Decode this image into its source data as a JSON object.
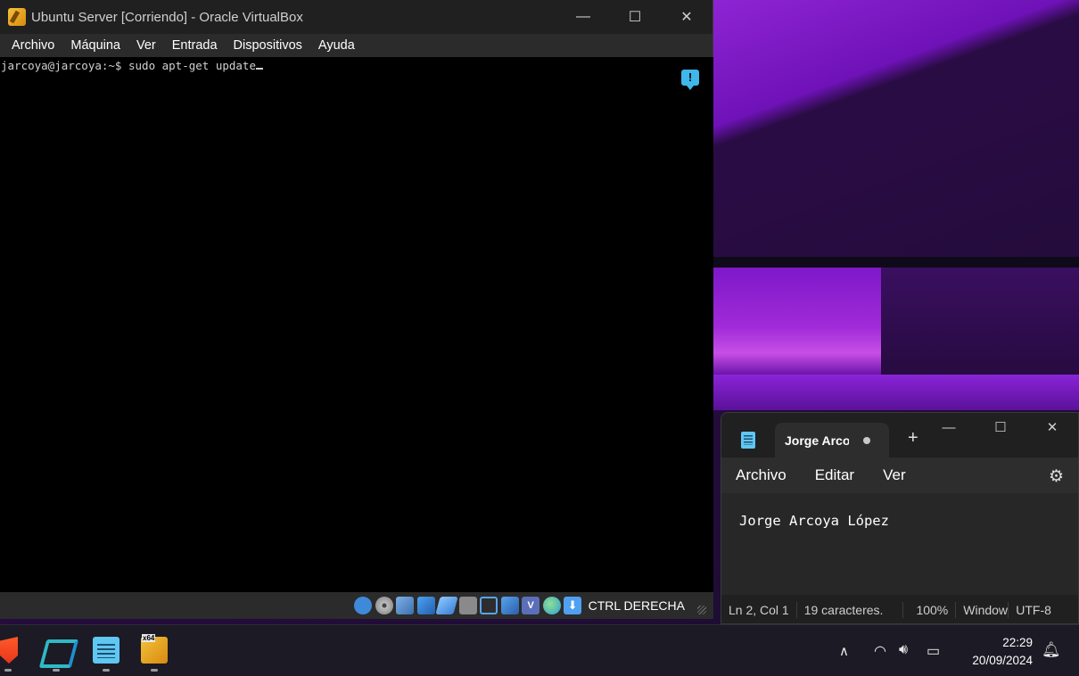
{
  "vbox": {
    "title": "Ubuntu Server [Corriendo] - Oracle VirtualBox",
    "menu": [
      "Archivo",
      "Máquina",
      "Ver",
      "Entrada",
      "Dispositivos",
      "Ayuda"
    ],
    "terminal_line": "jarcoya@jarcoya:~$ sudo apt-get update",
    "host_key": "CTRL DERECHA",
    "status_icons": [
      "hard-disk-icon",
      "optical-drive-icon",
      "network-icon",
      "usb-icon",
      "pen-icon",
      "shared-folder-icon",
      "display-icon",
      "recording-icon",
      "vtx-icon",
      "mouse-integration-icon",
      "keyboard-icon"
    ]
  },
  "notepad": {
    "tab_title": "Jorge Arcoya López",
    "menu": [
      "Archivo",
      "Editar",
      "Ver"
    ],
    "content": "Jorge Arcoya López",
    "status": {
      "position": "Ln 2, Col 1",
      "chars": "19 caracteres.",
      "zoom": "100%",
      "line_ending": "Windows (CRLF)",
      "encoding": "UTF-8"
    }
  },
  "taskbar": {
    "apps": [
      "brave-icon",
      "visual-studio-icon",
      "notepad-icon",
      "virtualbox-icon"
    ],
    "time": "22:29",
    "date": "20/09/2024"
  }
}
